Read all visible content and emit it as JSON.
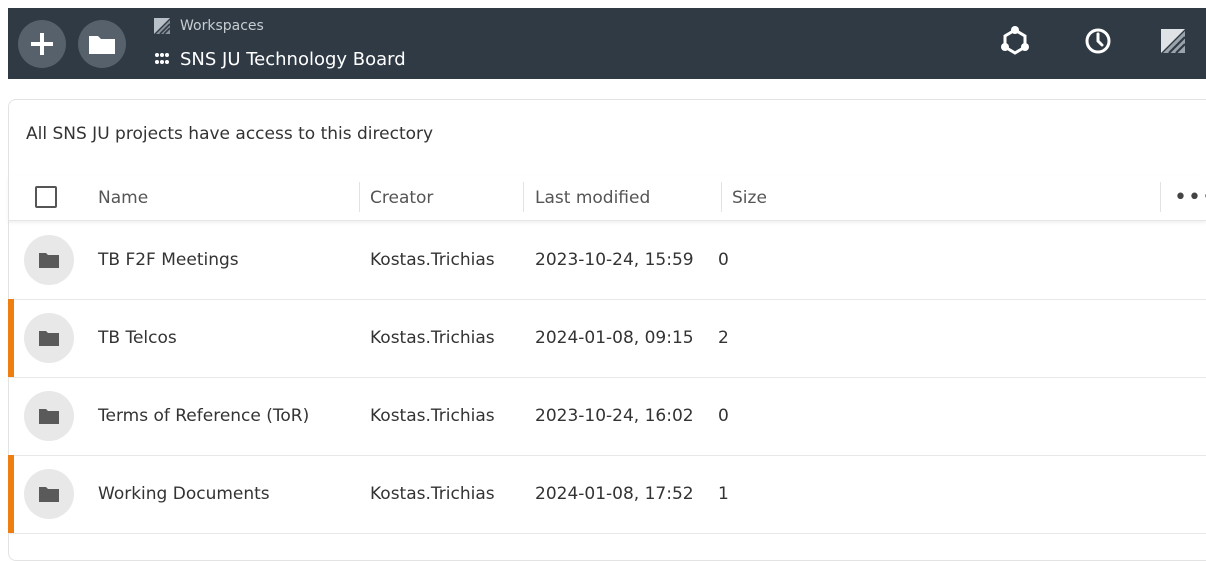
{
  "header": {
    "workspace_label": "Workspaces",
    "board_title": "SNS JU Technology Board"
  },
  "panel": {
    "info": "All SNS JU projects have access to this directory"
  },
  "table": {
    "columns": {
      "name": "Name",
      "creator": "Creator",
      "modified": "Last modified",
      "size": "Size",
      "more": "•••"
    },
    "rows": [
      {
        "name": "TB F2F Meetings",
        "creator": "Kostas.Trichias",
        "modified": "2023-10-24, 15:59",
        "size": "0",
        "highlighted": false
      },
      {
        "name": "TB Telcos",
        "creator": "Kostas.Trichias",
        "modified": "2024-01-08, 09:15",
        "size": "2",
        "highlighted": true
      },
      {
        "name": "Terms of Reference (ToR)",
        "creator": "Kostas.Trichias",
        "modified": "2023-10-24, 16:02",
        "size": "0",
        "highlighted": false
      },
      {
        "name": "Working Documents",
        "creator": "Kostas.Trichias",
        "modified": "2024-01-08, 17:52",
        "size": "1",
        "highlighted": true
      }
    ]
  },
  "icons": {
    "add": "plus-icon",
    "folder": "folder-icon",
    "logo": "logo-icon",
    "grid": "grid-icon",
    "community": "community-icon",
    "history": "clock-icon"
  },
  "colors": {
    "topbar": "#2f3a45",
    "accent": "#f07d10",
    "button": "#56616c"
  }
}
